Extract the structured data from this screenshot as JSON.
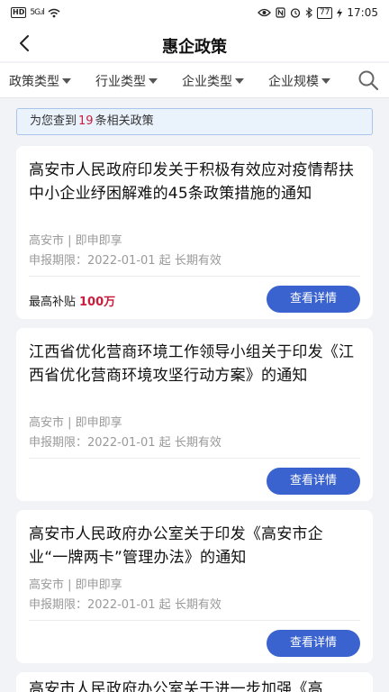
{
  "status_bar": {
    "left_badge": "HD",
    "signal": "5G.ıl",
    "battery": "77",
    "time": "17:05"
  },
  "header": {
    "title": "惠企政策"
  },
  "filters": [
    {
      "label": "政策类型"
    },
    {
      "label": "行业类型"
    },
    {
      "label": "企业类型"
    },
    {
      "label": "企业规模"
    }
  ],
  "banner": {
    "prefix": "为您查到",
    "count": "19",
    "suffix": "条相关政策"
  },
  "policies": [
    {
      "title": "高安市人民政府印发关于积极有效应对疫情帮扶中小企业纾困解难的45条政策措施的通知",
      "region": "高安市 | 即申即享",
      "deadline": "申报期限：2022-01-01 起 长期有效",
      "subsidy_label": "最高补贴",
      "subsidy_amount": "100万",
      "button": "查看详情"
    },
    {
      "title": "江西省优化营商环境工作领导小组关于印发《江西省优化营商环境攻坚行动方案》的通知",
      "region": "高安市 | 即申即享",
      "deadline": "申报期限：2022-01-01 起 长期有效",
      "button": "查看详情"
    },
    {
      "title": "高安市人民政府办公室关于印发《高安市企业“一牌两卡”管理办法》的通知",
      "region": "高安市 | 即申即享",
      "deadline": "申报期限：2022-01-01 起 长期有效",
      "button": "查看详情"
    },
    {
      "title": "高安市人民政府办公室关于进一步加强《高"
    }
  ],
  "colors": {
    "accent": "#3a63cf",
    "highlight": "#c81d3c",
    "background": "#f2f3f6"
  }
}
